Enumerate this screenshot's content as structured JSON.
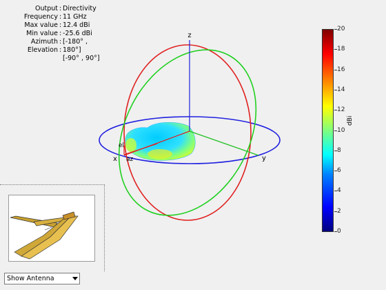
{
  "info": [
    {
      "key": "Output",
      "value": "Directivity"
    },
    {
      "key": "Frequency",
      "value": "11 GHz"
    },
    {
      "key": "Max value",
      "value": "12.4 dBi"
    },
    {
      "key": "Min value",
      "value": "-25.6 dBi"
    },
    {
      "key": "Azimuth",
      "value": "[-180° ,"
    },
    {
      "key": "Elevation",
      "value": "180°]"
    },
    {
      "key": "",
      "value": "[-90° , 90°]"
    }
  ],
  "axes": {
    "x": "x",
    "y": "y",
    "z": "z",
    "az": "az",
    "el": "el"
  },
  "colorbar": {
    "unit": "dBi",
    "min": 0,
    "max": 20,
    "ticks": [
      "20",
      "18",
      "16",
      "14",
      "12",
      "10",
      "8",
      "6",
      "4",
      "2",
      "0"
    ]
  },
  "antenna_view": {
    "select_label": "Show Antenna"
  },
  "colors": {
    "circle_xy": "#2020e0",
    "circle_xz": "#e02020",
    "circle_yz": "#20d020",
    "axis": "#2020e0"
  }
}
